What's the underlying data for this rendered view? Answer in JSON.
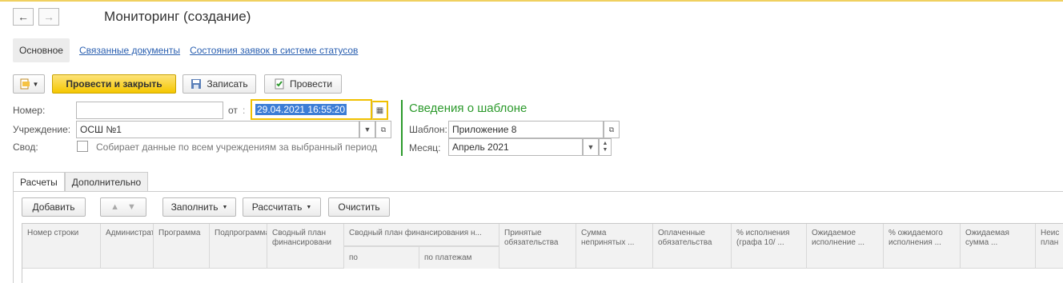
{
  "window": {
    "title": "Мониторинг (создание)"
  },
  "nav": {
    "back": "←",
    "forward": "→"
  },
  "top_tabs": [
    "Основное",
    "Связанные документы",
    "Состояния заявок в системе статусов"
  ],
  "toolbar": {
    "post_close": "Провести и закрыть",
    "save": "Записать",
    "post": "Провести"
  },
  "form": {
    "number_label": "Номер:",
    "number_value": "",
    "date_label": "от",
    "date_value": "29.04.2021 16:55:20",
    "org_label": "Учреждение:",
    "org_value": "ОСШ №1",
    "summary_label": "Свод:",
    "summary_checkbox_text": "Собирает данные по всем учреждениям за выбранный период"
  },
  "template": {
    "section_title": "Сведения о шаблоне",
    "template_label": "Шаблон:",
    "template_value": "Приложение 8",
    "month_label": "Месяц:",
    "month_value": "Апрель 2021"
  },
  "inner_tabs": [
    "Расчеты",
    "Дополнительно"
  ],
  "grid_toolbar": {
    "add": "Добавить",
    "fill": "Заполнить",
    "calculate": "Рассчитать",
    "clear": "Очистить"
  },
  "table": {
    "columns": [
      "Номер строки",
      "Администратор",
      "Программа",
      "Подпрограмма",
      "Сводный план финансировани",
      "Сводный план финансирования н...",
      "Принятые обязательства",
      "Сумма непринятых ...",
      "Оплаченные обязательства",
      "% исполнения (графа 10/ ...",
      "Ожидаемое исполнение ...",
      "% ожидаемого исполнения ...",
      "Ожидаемая сумма ...",
      "Неис план"
    ],
    "subcolumns": [
      "по",
      "по платежам"
    ]
  }
}
